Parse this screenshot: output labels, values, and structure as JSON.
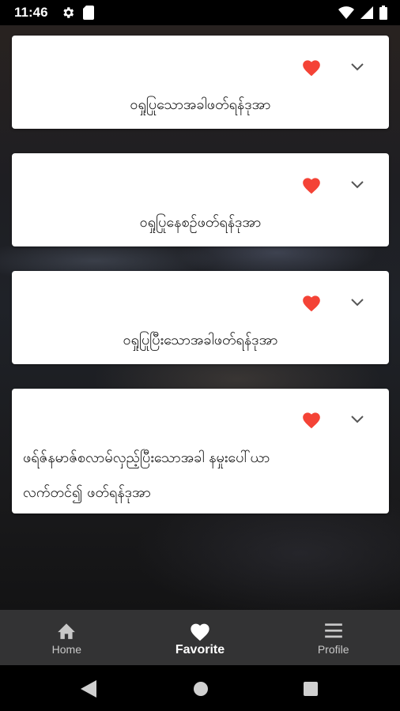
{
  "status": {
    "time": "11:46",
    "left_icons": [
      "gear-icon",
      "sim-card-icon"
    ],
    "right_icons": [
      "wifi-icon",
      "signal-icon",
      "battery-icon"
    ]
  },
  "cards": [
    {
      "text": "ဝရှုပြုသောအခါဖတ်ရန်ဒုအာ",
      "favorited": true,
      "favorite_color": "#f44336"
    },
    {
      "text": "ဝရှုပြုနေစဉ်ဖတ်ရန်ဒုအာ",
      "favorited": true,
      "favorite_color": "#f44336"
    },
    {
      "text": "ဝရှုပြုပြီးသောအခါဖတ်ရန်ဒုအာ",
      "favorited": true,
      "favorite_color": "#f44336"
    },
    {
      "text_lines": [
        "ဖရ်ဇ်နမာဇ်စလာမ်လှည့်ပြီးသောအခါ နမှုးပေါ်ယာ",
        "လက်တင်၍ ဖတ်ရန်ဒုအာ"
      ],
      "favorited": true,
      "favorite_color": "#f44336"
    }
  ],
  "bottom_nav": {
    "items": [
      {
        "label": "Home",
        "icon": "home-icon"
      },
      {
        "label": "Favorite",
        "icon": "heart-icon",
        "active": true
      },
      {
        "label": "Profile",
        "icon": "menu-icon"
      }
    ]
  },
  "system_nav": [
    "back-icon",
    "home-circle-icon",
    "recents-icon"
  ],
  "colors": {
    "accent_heart": "#f44336",
    "nav_bg": "#333334",
    "card_bg": "#ffffff"
  }
}
